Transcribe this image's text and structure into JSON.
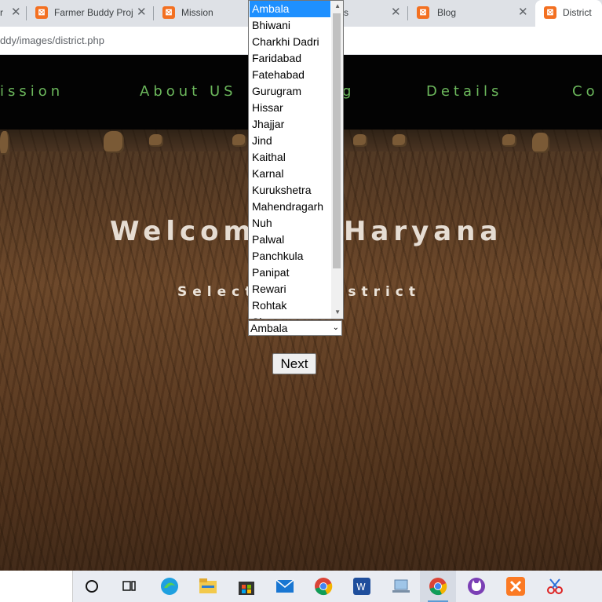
{
  "browser": {
    "tabs": [
      {
        "title": "r",
        "close": "✕"
      },
      {
        "title": "Farmer Buddy Proj",
        "close": "✕"
      },
      {
        "title": "Mission",
        "close": ""
      },
      {
        "title": "s",
        "close": "✕"
      },
      {
        "title": "Blog",
        "close": "✕"
      },
      {
        "title": "District",
        "close": ""
      }
    ],
    "address": "ddy/images/district.php"
  },
  "nav": {
    "items": [
      "ission",
      "About US",
      "g",
      "Details",
      "Co"
    ],
    "color": "#6cb85c"
  },
  "hero": {
    "welcome_left": "Welcom",
    "welcome_right": "Haryana",
    "select_left": "Select",
    "select_right": "strict"
  },
  "form": {
    "selected_value": "Ambala",
    "next_label": "Next"
  },
  "dropdown": {
    "options": [
      "Ambala",
      "Bhiwani",
      "Charkhi Dadri",
      "Faridabad",
      "Fatehabad",
      "Gurugram",
      "Hissar",
      "Jhajjar",
      "Jind",
      "Kaithal",
      "Karnal",
      "Kurukshetra",
      "Mahendragarh",
      "Nuh",
      "Palwal",
      "Panchkula",
      "Panipat",
      "Rewari",
      "Rohtak",
      "Si"
    ],
    "selected_index": 0,
    "highlight_color": "#1e90ff"
  },
  "taskbar": {
    "icons": [
      "cortana-icon",
      "task-view-icon",
      "edge-icon",
      "file-explorer-icon",
      "store-icon",
      "mail-icon",
      "chrome-icon",
      "app-w-icon",
      "laptop-icon",
      "chrome-active-icon",
      "cat-app-icon",
      "xampp-icon",
      "snip-icon"
    ]
  }
}
